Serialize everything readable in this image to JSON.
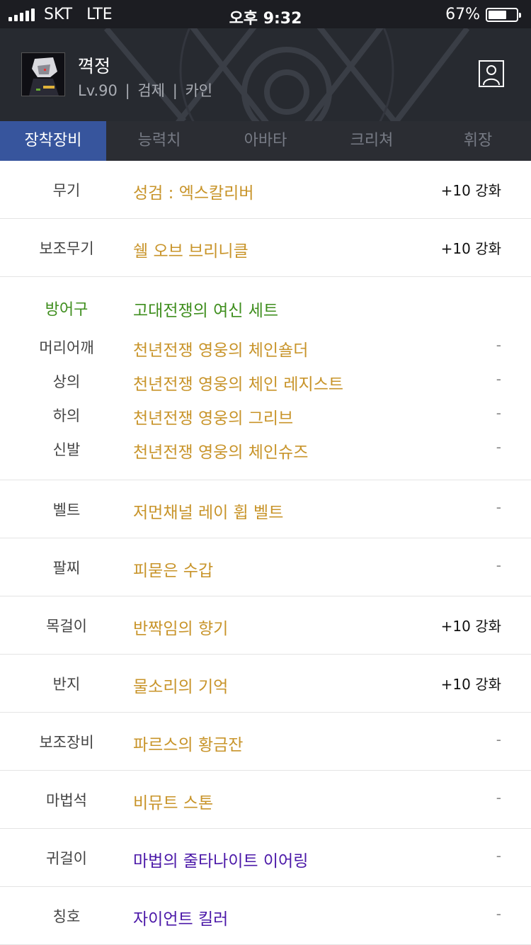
{
  "status": {
    "carrier": "SKT",
    "network": "LTE",
    "time": "오후 9:32",
    "battery": "67%",
    "battery_level": 0.67
  },
  "profile": {
    "name": "껵정",
    "level": "Lv.90",
    "sep1": "|",
    "job": "검제",
    "sep2": "|",
    "server": "카인"
  },
  "tabs": [
    {
      "label": "장착장비",
      "active": true
    },
    {
      "label": "능력치",
      "active": false
    },
    {
      "label": "아바타",
      "active": false
    },
    {
      "label": "크리쳐",
      "active": false
    },
    {
      "label": "휘장",
      "active": false
    }
  ],
  "equipment": {
    "weapon": {
      "slot": "무기",
      "name": "성검 : 엑스칼리버",
      "value": "+10 강화"
    },
    "subweapon": {
      "slot": "보조무기",
      "name": "쉘 오브 브리니클",
      "value": "+10 강화"
    },
    "armor": {
      "slot": "방어구",
      "set_name": "고대전쟁의 여신 세트",
      "parts": [
        {
          "slot": "머리어깨",
          "name": "천년전쟁 영웅의 체인숄더",
          "value": "-"
        },
        {
          "slot": "상의",
          "name": "천년전쟁 영웅의 체인 레지스트",
          "value": "-"
        },
        {
          "slot": "하의",
          "name": "천년전쟁 영웅의 그리브",
          "value": "-"
        },
        {
          "slot": "신발",
          "name": "천년전쟁 영웅의 체인슈즈",
          "value": "-"
        }
      ]
    },
    "belt": {
      "slot": "벨트",
      "name": "저먼채널 레이 휩 벨트",
      "value": "-"
    },
    "bracelet": {
      "slot": "팔찌",
      "name": "피묻은 수갑",
      "value": "-"
    },
    "necklace": {
      "slot": "목걸이",
      "name": "반짝임의 향기",
      "value": "+10 강화"
    },
    "ring": {
      "slot": "반지",
      "name": "물소리의 기억",
      "value": "+10 강화"
    },
    "support": {
      "slot": "보조장비",
      "name": "파르스의 황금잔",
      "value": "-"
    },
    "magicstone": {
      "slot": "마법석",
      "name": "비뮤트 스톤",
      "value": "-"
    },
    "earring": {
      "slot": "귀걸이",
      "name": "마법의 줄타나이트 이어링",
      "value": "-"
    },
    "title": {
      "slot": "칭호",
      "name": "자이언트 킬러",
      "value": "-"
    }
  },
  "colors": {
    "epic": "#c8942a",
    "unique": "#4b18a8",
    "set": "#3f8e1e",
    "tab_active": "#37559d"
  }
}
